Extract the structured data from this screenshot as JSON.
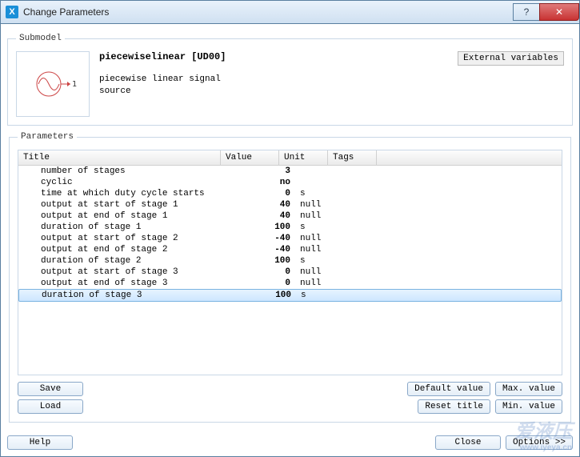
{
  "window": {
    "title": "Change Parameters",
    "help_symbol": "?",
    "close_symbol": "✕"
  },
  "submodel": {
    "legend": "Submodel",
    "name": "piecewiselinear [UD00]",
    "desc_line1": "piecewise linear signal",
    "desc_line2": "source",
    "icon_port_label": "1",
    "external_variables_btn": "External variables"
  },
  "parameters": {
    "legend": "Parameters",
    "headers": {
      "title": "Title",
      "value": "Value",
      "unit": "Unit",
      "tags": "Tags"
    },
    "rows": [
      {
        "title": "number of stages",
        "value": "3",
        "unit": ""
      },
      {
        "title": "cyclic",
        "value": "no",
        "unit": ""
      },
      {
        "title": "time at which duty cycle starts",
        "value": "0",
        "unit": "s"
      },
      {
        "title": "output at start of stage 1",
        "value": "40",
        "unit": "null"
      },
      {
        "title": "output at end of stage 1",
        "value": "40",
        "unit": "null"
      },
      {
        "title": "duration of stage 1",
        "value": "100",
        "unit": "s"
      },
      {
        "title": "output at start of stage 2",
        "value": "-40",
        "unit": "null"
      },
      {
        "title": "output at end of stage 2",
        "value": "-40",
        "unit": "null"
      },
      {
        "title": "duration of stage 2",
        "value": "100",
        "unit": "s"
      },
      {
        "title": "output at start of stage 3",
        "value": "0",
        "unit": "null"
      },
      {
        "title": "output at end of stage 3",
        "value": "0",
        "unit": "null"
      },
      {
        "title": "duration of stage 3",
        "value": "100",
        "unit": "s",
        "selected": true
      }
    ]
  },
  "buttons": {
    "save": "Save",
    "load": "Load",
    "default_value": "Default value",
    "max_value": "Max. value",
    "reset_title": "Reset title",
    "min_value": "Min. value",
    "help": "Help",
    "close": "Close",
    "options": "Options >>"
  },
  "watermark": {
    "main": "爱液压",
    "sub": "www.iyeya.cn"
  }
}
